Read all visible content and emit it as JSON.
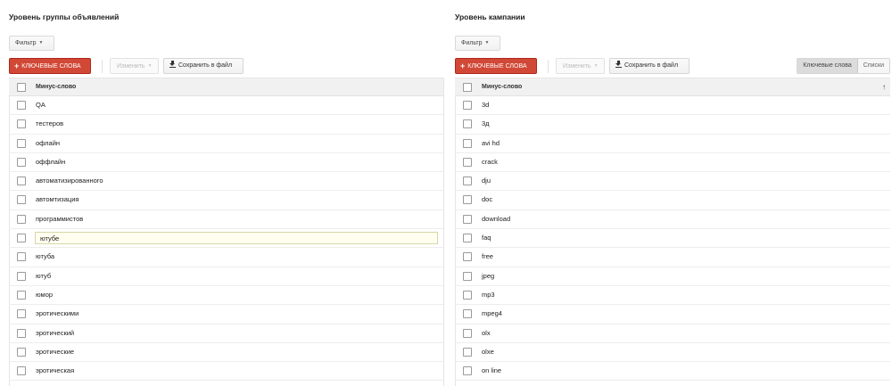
{
  "left": {
    "title": "Уровень группы объявлений",
    "filter_label": "Фильтр",
    "keywords_btn": "КЛЮЧЕВЫЕ СЛОВА",
    "change_btn": "Изменить",
    "save_btn": "Сохранить в файл",
    "column_header": "Минус-слово",
    "rows": [
      "QA",
      "тестеров",
      "офлайн",
      "оффлайн",
      "автоматизированного",
      "автомтизация",
      "программистов",
      "ютубе",
      "ютуба",
      "ютуб",
      "юмор",
      "эротическими",
      "эротический",
      "эротические",
      "эротическая"
    ],
    "editing_row": 7
  },
  "right": {
    "title": "Уровень кампании",
    "filter_label": "Фильтр",
    "keywords_btn": "КЛЮЧЕВЫЕ СЛОВА",
    "change_btn": "Изменить",
    "save_btn": "Сохранить в файл",
    "tab_keywords": "Ключевые слова",
    "tab_lists": "Списки",
    "column_header": "Минус-слово",
    "sort_arrow": "↑",
    "rows": [
      "3d",
      "3д",
      "avi hd",
      "crack",
      "dju",
      "doc",
      "download",
      "faq",
      "free",
      "jpeg",
      "mp3",
      "mpeg4",
      "olx",
      "olxe",
      "on line"
    ]
  },
  "icons": {
    "plus": "+",
    "caret": "▼"
  },
  "colors": {
    "accent_red": "#d14836",
    "header_bg": "#f1f1f1",
    "editing_bg": "#fffff0"
  }
}
